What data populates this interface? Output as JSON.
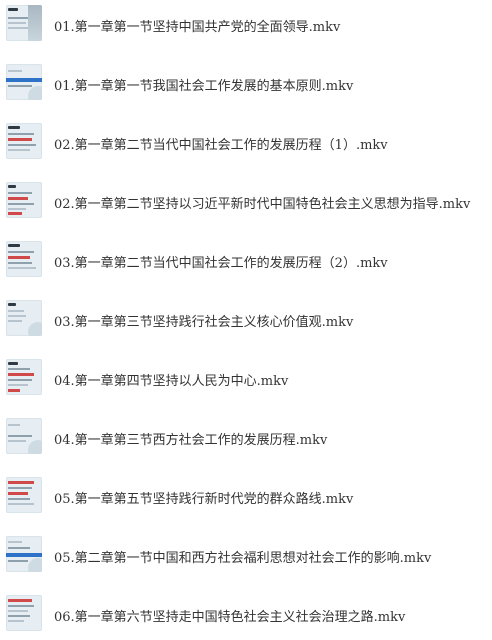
{
  "files": [
    {
      "name": "01.第一章第一节坚持中国共产党的全面领导.mkv"
    },
    {
      "name": "01.第一章第一节我国社会工作发展的基本原则.mkv"
    },
    {
      "name": "02.第一章第二节当代中国社会工作的发展历程（1）.mkv"
    },
    {
      "name": "02.第一章第二节坚持以习近平新时代中国特色社会主义思想为指导.mkv"
    },
    {
      "name": "03.第一章第二节当代中国社会工作的发展历程（2）.mkv"
    },
    {
      "name": "03.第一章第三节坚持践行社会主义核心价值观.mkv"
    },
    {
      "name": "04.第一章第四节坚持以人民为中心.mkv"
    },
    {
      "name": "04.第一章第三节西方社会工作的发展历程.mkv"
    },
    {
      "name": "05.第一章第五节坚持践行新时代党的群众路线.mkv"
    },
    {
      "name": "05.第二章第一节中国和西方社会福利思想对社会工作的影响.mkv"
    },
    {
      "name": "06.第一章第六节坚持走中国特色社会主义社会治理之路.mkv"
    }
  ],
  "icon": "video-thumbnail-icon"
}
